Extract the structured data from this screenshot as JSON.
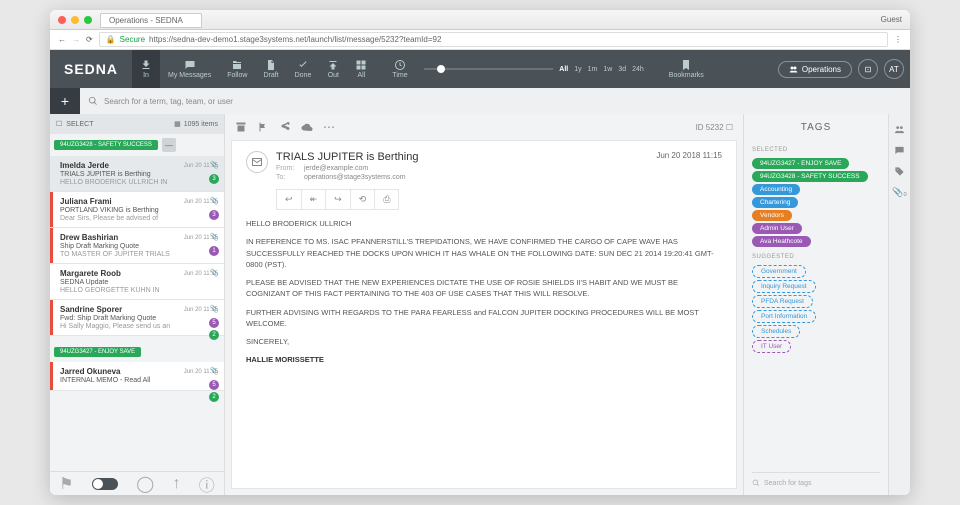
{
  "titlebar": {
    "tab": "Operations - SEDNA",
    "guest": "Guest"
  },
  "addr": {
    "secure": "Secure",
    "url": "https://sedna-dev-demo1.stage3systems.net/launch/list/message/5232?teamId=92"
  },
  "logo": "SEDNA",
  "nav": {
    "in": "In",
    "my": "My Messages",
    "follow": "Follow",
    "draft": "Draft",
    "done": "Done",
    "out": "Out",
    "all": "All",
    "time": "Time",
    "bookmarks": "Bookmarks"
  },
  "timeline": {
    "all": "All",
    "labels": [
      "1y",
      "1m",
      "1w",
      "3d",
      "24h"
    ]
  },
  "ops": "Operations",
  "avatar": "AT",
  "search": {
    "placeholder": "Search for a term, tag, team, or user"
  },
  "list": {
    "select": "SELECT",
    "count": "1095 items",
    "topTag": "94UZG3428 - SAFETY SUCCESS",
    "items": [
      {
        "sender": "Imelda Jerde",
        "date": "Jun 20 11:15",
        "subj": "TRIALS JUPITER is Berthing",
        "prev": "HELLO BRODERICK ULLRICH IN",
        "sel": true,
        "badge": "3",
        "bcls": "green"
      },
      {
        "sender": "Juliana Frami",
        "date": "Jun 20 11:15",
        "subj": "PORTLAND VIKING is Berthing",
        "prev": "Dear Sirs, Please be advised of",
        "badge": "3",
        "bcls": "purple",
        "bar": "red"
      },
      {
        "sender": "Drew Bashirian",
        "date": "Jun 20 11:15",
        "subj": "Ship Draft Marking Quote",
        "prev": "TO MASTER OF JUPITER TRIALS",
        "badge": "1",
        "bcls": "purple",
        "bar": "red"
      },
      {
        "sender": "Margarete Roob",
        "date": "Jun 20 11:15",
        "subj": "SEDNA Update",
        "prev": "HELLO GEORGETTE KUHN IN"
      },
      {
        "sender": "Sandrine Sporer",
        "date": "Jun 20 11:15",
        "subj": "Fwd: Ship Draft Marking Quote",
        "prev": "Hi Sally Maggio, Please send us an",
        "badge": "5",
        "bcls": "purple",
        "bar": "red",
        "badge2": "2"
      },
      {
        "sender": "Jarred Okuneva",
        "date": "Jun 20 11:15",
        "subj": "INTERNAL MEMO - Read All",
        "prev": "",
        "badge": "5",
        "bcls": "purple",
        "bar": "red",
        "badge2": "2"
      }
    ],
    "midTag": "94UZG3427 - ENJOY SAVE"
  },
  "message": {
    "id": "ID 5232",
    "title": "TRIALS JUPITER is Berthing",
    "date": "Jun 20 2018 11:15",
    "from": "jerde@example.com",
    "to": "operations@stage3systems.com",
    "fromLbl": "From:",
    "toLbl": "To:",
    "body": [
      "HELLO BRODERICK ULLRICH",
      "IN REFERENCE TO MS. ISAC PFANNERSTILL'S TREPIDATIONS, WE HAVE CONFIRMED THE CARGO OF CAPE WAVE HAS SUCCESSFULLY REACHED THE DOCKS UPON WHICH IT HAS WHALE ON THE FOLLOWING DATE: SUN DEC 21 2014 19:20:41 GMT-0800 (PST).",
      "PLEASE BE ADVISED THAT THE NEW EXPERIENCES DICTATE THE USE OF ROSIE SHIELDS II'S HABIT AND WE MUST BE COGNIZANT OF THIS FACT PERTAINING TO THE 403 OF USE CASES THAT THIS WILL RESOLVE.",
      "FURTHER ADVISING WITH REGARDS TO THE PARA FEARLESS and FALCON JUPITER DOCKING PROCEDURES WILL BE MOST WELCOME.",
      "SINCERELY,"
    ],
    "sig": "HALLIE MORISSETTE"
  },
  "tags": {
    "title": "TAGS",
    "selected": "SELECTED",
    "suggested": "SUGGESTED",
    "sel": [
      {
        "t": "94UZG3427 - ENJOY SAVE",
        "c": "g"
      },
      {
        "t": "94UZG3428 - SAFETY SUCCESS",
        "c": "g"
      },
      {
        "t": "Accounting",
        "c": "b"
      },
      {
        "t": "Chartering",
        "c": "b"
      },
      {
        "t": "Vendors",
        "c": "o"
      },
      {
        "t": "Admin User",
        "c": "p"
      },
      {
        "t": "Ava Heathcote",
        "c": "p"
      }
    ],
    "sug": [
      {
        "t": "Government",
        "c": "ob"
      },
      {
        "t": "Inquiry Request",
        "c": "ob"
      },
      {
        "t": "PFDA Request",
        "c": "ob"
      },
      {
        "t": "Port Information",
        "c": "ob"
      },
      {
        "t": "Schedules",
        "c": "ob"
      },
      {
        "t": "IT User",
        "c": "op"
      }
    ],
    "search": "Search for tags"
  }
}
